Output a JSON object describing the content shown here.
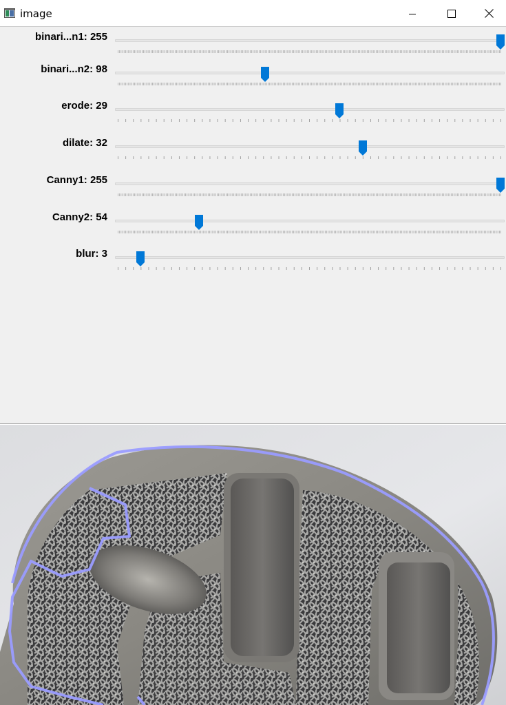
{
  "window": {
    "title": "image"
  },
  "controls": {
    "minimize": "minimize",
    "maximize": "maximize",
    "close": "close"
  },
  "trackbars": [
    {
      "label": "binari...n1: 255",
      "value": 255,
      "max": 255,
      "ticks": 255
    },
    {
      "label": "binari...n2: 98",
      "value": 98,
      "max": 255,
      "ticks": 255
    },
    {
      "label": "erode: 29",
      "value": 29,
      "max": 50,
      "ticks": 50
    },
    {
      "label": "dilate: 32",
      "value": 32,
      "max": 50,
      "ticks": 50
    },
    {
      "label": "Canny1: 255",
      "value": 255,
      "max": 255,
      "ticks": 255
    },
    {
      "label": "Canny2: 54",
      "value": 54,
      "max": 255,
      "ticks": 255
    },
    {
      "label": "blur: 3",
      "value": 3,
      "max": 50,
      "ticks": 50
    }
  ],
  "colors": {
    "thumb": "#0078d7",
    "contour": "#9a9cff",
    "panel": "#f0f0f0"
  },
  "icons": {
    "app": "opencv-window-icon"
  }
}
